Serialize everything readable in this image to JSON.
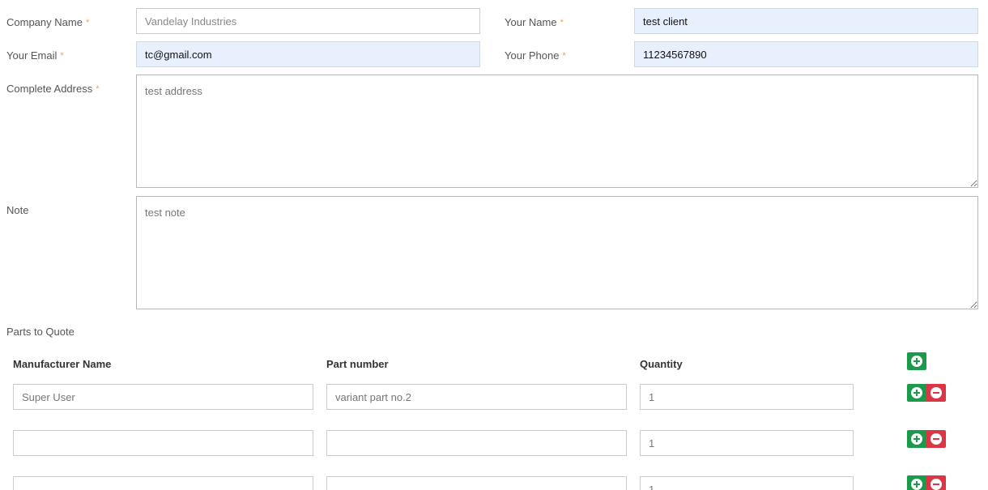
{
  "form": {
    "company_name": {
      "label": "Company Name",
      "required_mark": "*",
      "placeholder": "Vandelay Industries",
      "value": ""
    },
    "your_name": {
      "label": "Your Name",
      "required_mark": "*",
      "value": "test client"
    },
    "your_email": {
      "label": "Your Email",
      "required_mark": "*",
      "value": "tc@gmail.com"
    },
    "your_phone": {
      "label": "Your Phone",
      "required_mark": "*",
      "value": "11234567890"
    },
    "address": {
      "label": "Complete Address",
      "required_mark": "*",
      "value": "test address"
    },
    "note": {
      "label": "Note",
      "value": "test note"
    }
  },
  "parts": {
    "section_label": "Parts to Quote",
    "headers": {
      "manufacturer": "Manufacturer Name",
      "part_number": "Part number",
      "quantity": "Quantity"
    },
    "rows": [
      {
        "manufacturer": "Super User",
        "part_number": "variant part no.2",
        "quantity": "1"
      },
      {
        "manufacturer": "",
        "part_number": "",
        "quantity": "1"
      },
      {
        "manufacturer": "",
        "part_number": "",
        "quantity": "1"
      }
    ]
  },
  "colors": {
    "add_button": "#1a9a4a",
    "remove_button": "#dc3545",
    "autofill_background": "#e8f0fe",
    "required_mark": "#f0a050"
  },
  "icons": {
    "add": "plus-circle-icon",
    "remove": "minus-circle-icon"
  }
}
